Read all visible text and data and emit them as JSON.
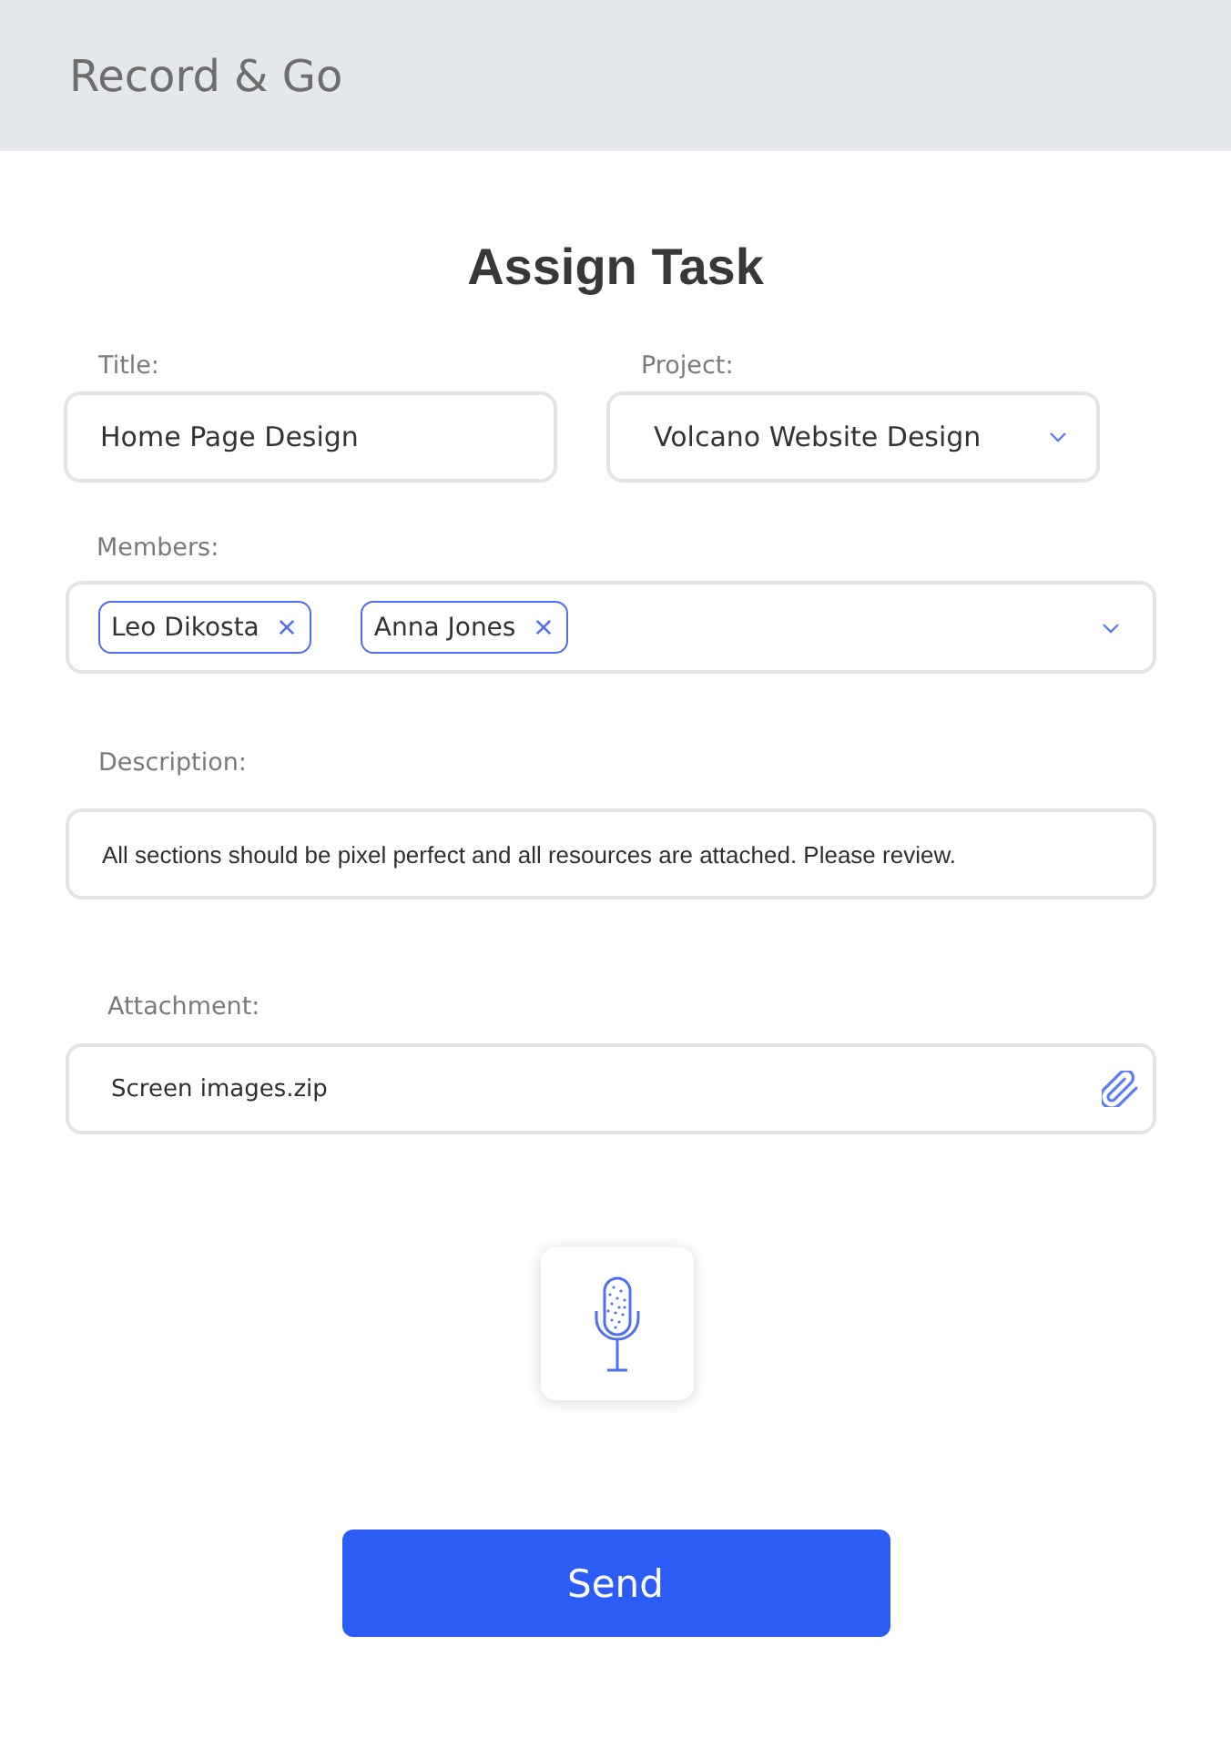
{
  "app_bar": {
    "title": "Record & Go"
  },
  "form": {
    "heading": "Assign Task",
    "title_field": {
      "label": "Title:",
      "value": "Home Page Design"
    },
    "project_field": {
      "label": "Project:",
      "value": "Volcano Website Design"
    },
    "members_field": {
      "label": "Members:",
      "members": [
        {
          "name": "Leo Dikosta"
        },
        {
          "name": "Anna Jones"
        }
      ]
    },
    "description_field": {
      "label": "Description:",
      "value": "All sections should be pixel perfect and all resources are attached. Please review."
    },
    "attachment_field": {
      "label": "Attachment:",
      "file_name": "Screen images.zip"
    },
    "send_button": {
      "label": "Send"
    }
  }
}
